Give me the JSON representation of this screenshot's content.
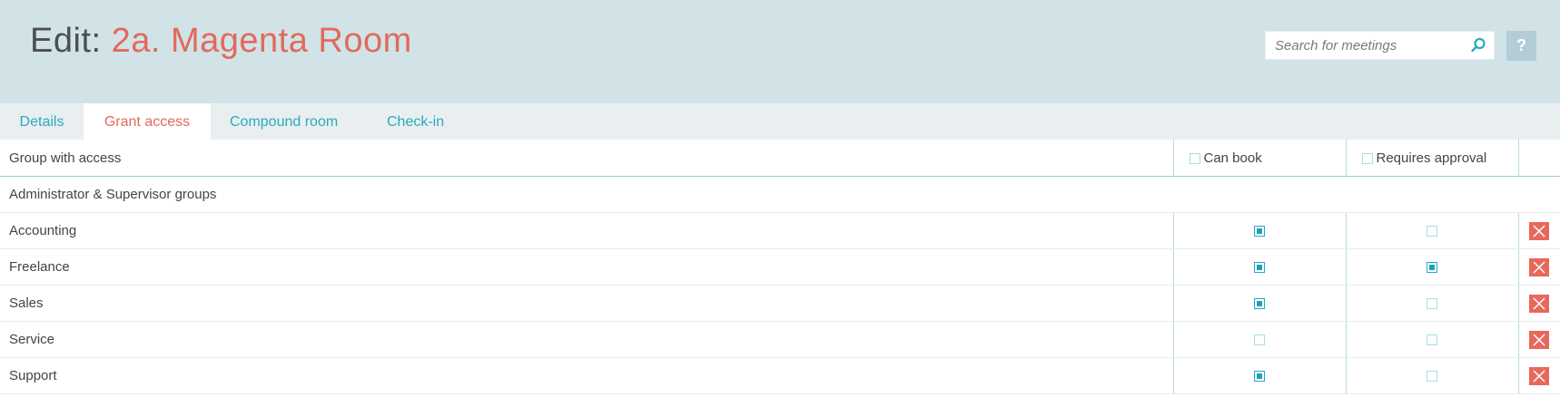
{
  "header": {
    "title_prefix": "Edit:",
    "room_name": "2a. Magenta Room",
    "search_placeholder": "Search for meetings",
    "search_icon": "search-icon",
    "help_label": "?"
  },
  "tabs": [
    {
      "label": "Details",
      "active": false
    },
    {
      "label": "Grant access",
      "active": true
    },
    {
      "label": "Compound room",
      "active": false
    },
    {
      "label": "Check-in",
      "active": false
    }
  ],
  "table": {
    "columns": {
      "group": "Group with access",
      "can_book": "Can book",
      "requires_approval": "Requires approval"
    },
    "section_label": "Administrator & Supervisor groups",
    "rows": [
      {
        "name": "Accounting",
        "can_book": true,
        "requires_approval": false
      },
      {
        "name": "Freelance",
        "can_book": true,
        "requires_approval": true
      },
      {
        "name": "Sales",
        "can_book": true,
        "requires_approval": false
      },
      {
        "name": "Service",
        "can_book": false,
        "requires_approval": false
      },
      {
        "name": "Support",
        "can_book": true,
        "requires_approval": false
      }
    ]
  },
  "colors": {
    "accent": "#2aa9c0",
    "brand_red": "#e16a5c",
    "header_bg": "#d1e3e6",
    "delete_bg": "#e8685c"
  }
}
